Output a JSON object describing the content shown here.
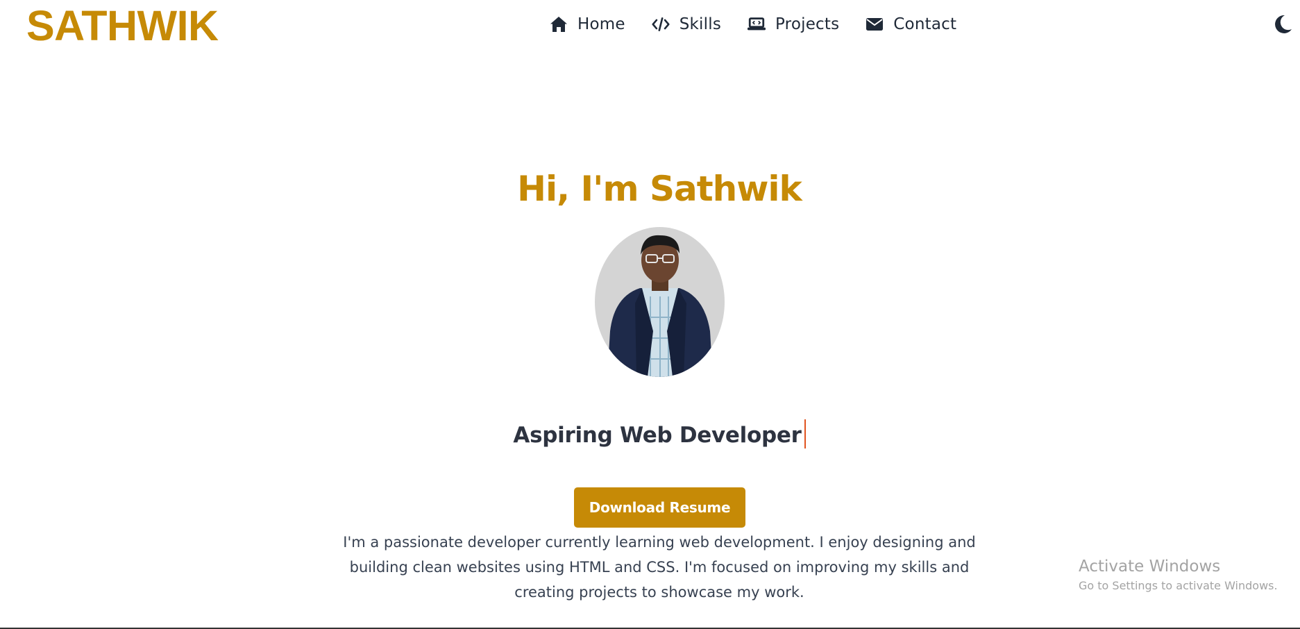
{
  "header": {
    "logo": "SATHWIK"
  },
  "nav": {
    "items": [
      {
        "label": "Home",
        "icon": "home-icon"
      },
      {
        "label": "Skills",
        "icon": "code-icon"
      },
      {
        "label": "Projects",
        "icon": "laptop-code-icon"
      },
      {
        "label": "Contact",
        "icon": "envelope-icon"
      }
    ],
    "theme_toggle_icon": "moon-icon"
  },
  "hero": {
    "title": "Hi, I'm Sathwik",
    "tagline": "Aspiring Web Developer",
    "button_label": "Download Resume",
    "about_lines": [
      "I'm a passionate developer currently learning web development. I enjoy designing and",
      "building clean websites using HTML and CSS. I'm focused on improving my skills and",
      "creating projects to showcase my work."
    ]
  },
  "watermark": {
    "line1": "Activate Windows",
    "line2": "Go to Settings to activate Windows."
  },
  "colors": {
    "accent": "#c68a06",
    "text": "#1f2937",
    "caret": "#e0531f",
    "avatar_bg": "#d4d4d4"
  }
}
